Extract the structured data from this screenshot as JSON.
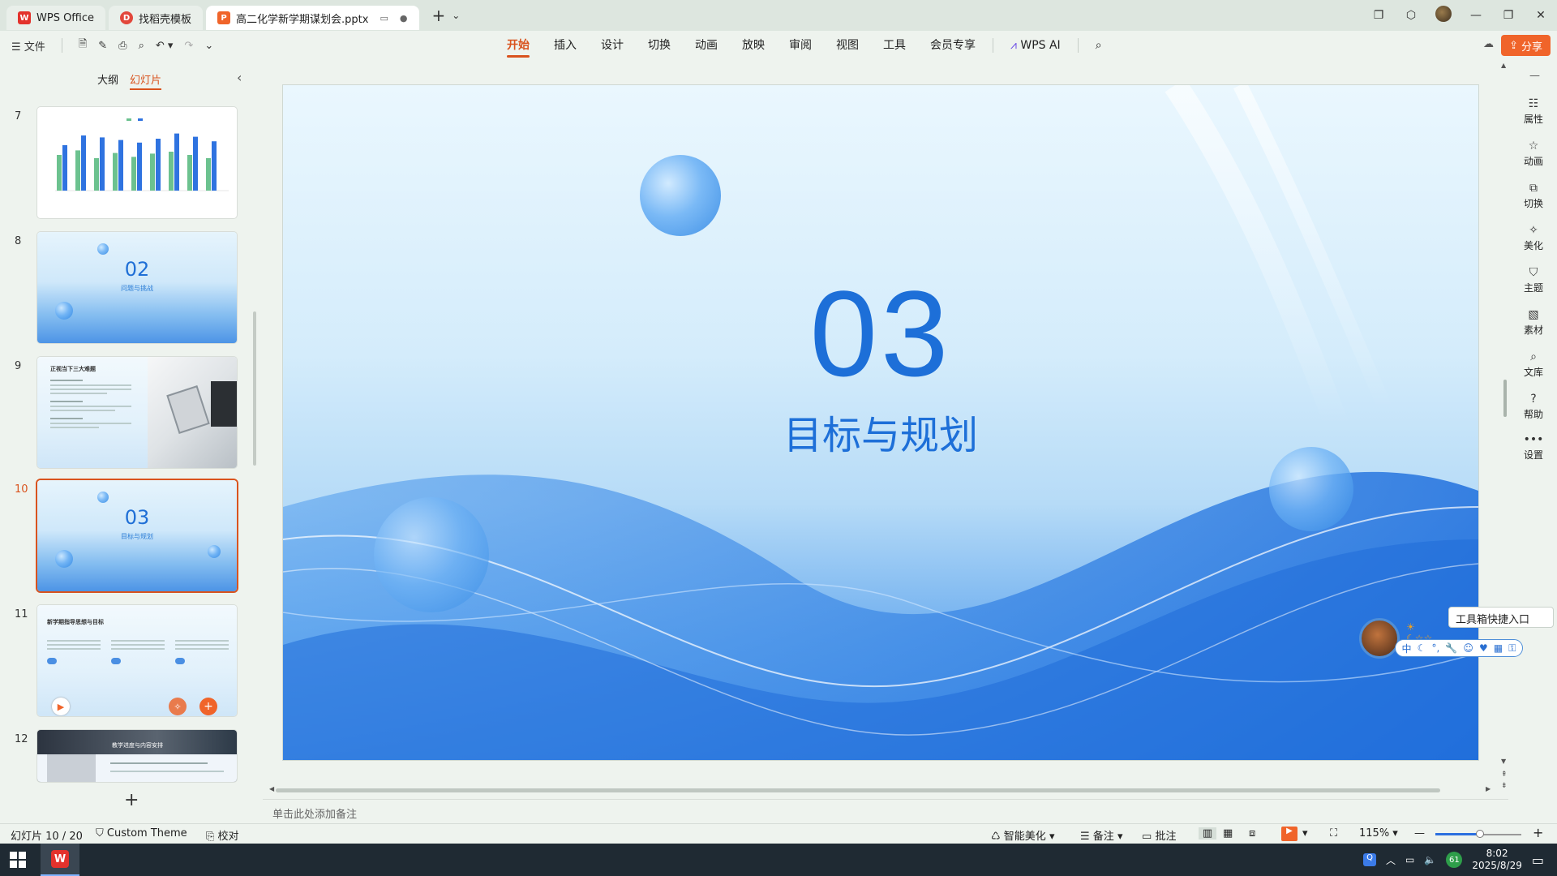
{
  "titlebar": {
    "tabs": [
      {
        "label": "WPS Office",
        "state": "inactive"
      },
      {
        "label": "找稻壳模板",
        "state": "inactive"
      },
      {
        "label": "高二化学新学期谋划会.pptx",
        "state": "active"
      }
    ],
    "colors": {
      "wps_red": "#e3322c",
      "pptx_orange": "#f0642a"
    }
  },
  "ribbon": {
    "file_label": "文件",
    "tabs": [
      "开始",
      "插入",
      "设计",
      "切换",
      "动画",
      "放映",
      "审阅",
      "视图",
      "工具",
      "会员专享",
      "WPS AI"
    ],
    "active_tab": "开始",
    "share_label": "分享",
    "accent_color": "#d9531e"
  },
  "leftpanel": {
    "tabs": [
      "大纲",
      "幻灯片"
    ],
    "active_tab": "幻灯片",
    "thumbs": [
      {
        "num": "7"
      },
      {
        "num": "8",
        "big": "02",
        "sub": "问题与挑战"
      },
      {
        "num": "9",
        "heading": "正视当下三大难题"
      },
      {
        "num": "10",
        "big": "03",
        "sub": "目标与规划",
        "selected": true
      },
      {
        "num": "11",
        "heading": "新学期指导思想与目标"
      },
      {
        "num": "12",
        "heading": "教学进度与内容安排"
      }
    ]
  },
  "slide": {
    "number": "03",
    "title": "目标与规划",
    "text_color": "#1d6fd8"
  },
  "notes_placeholder": "单击此处添加备注",
  "rightbar": {
    "items": [
      "属性",
      "动画",
      "切换",
      "美化",
      "主题",
      "素材",
      "文库",
      "帮助",
      "设置"
    ]
  },
  "float_widget": {
    "tooltip": "工具箱快捷入口",
    "bar_first": "中"
  },
  "statusbar": {
    "slide_pos": "幻灯片 10 / 20",
    "theme": "Custom Theme",
    "proof": "校对",
    "beautify": "智能美化",
    "notes": "备注",
    "comments": "批注",
    "zoom": "115%"
  },
  "taskbar": {
    "badge": "61",
    "time": "8:02",
    "date": "2025/8/29"
  }
}
